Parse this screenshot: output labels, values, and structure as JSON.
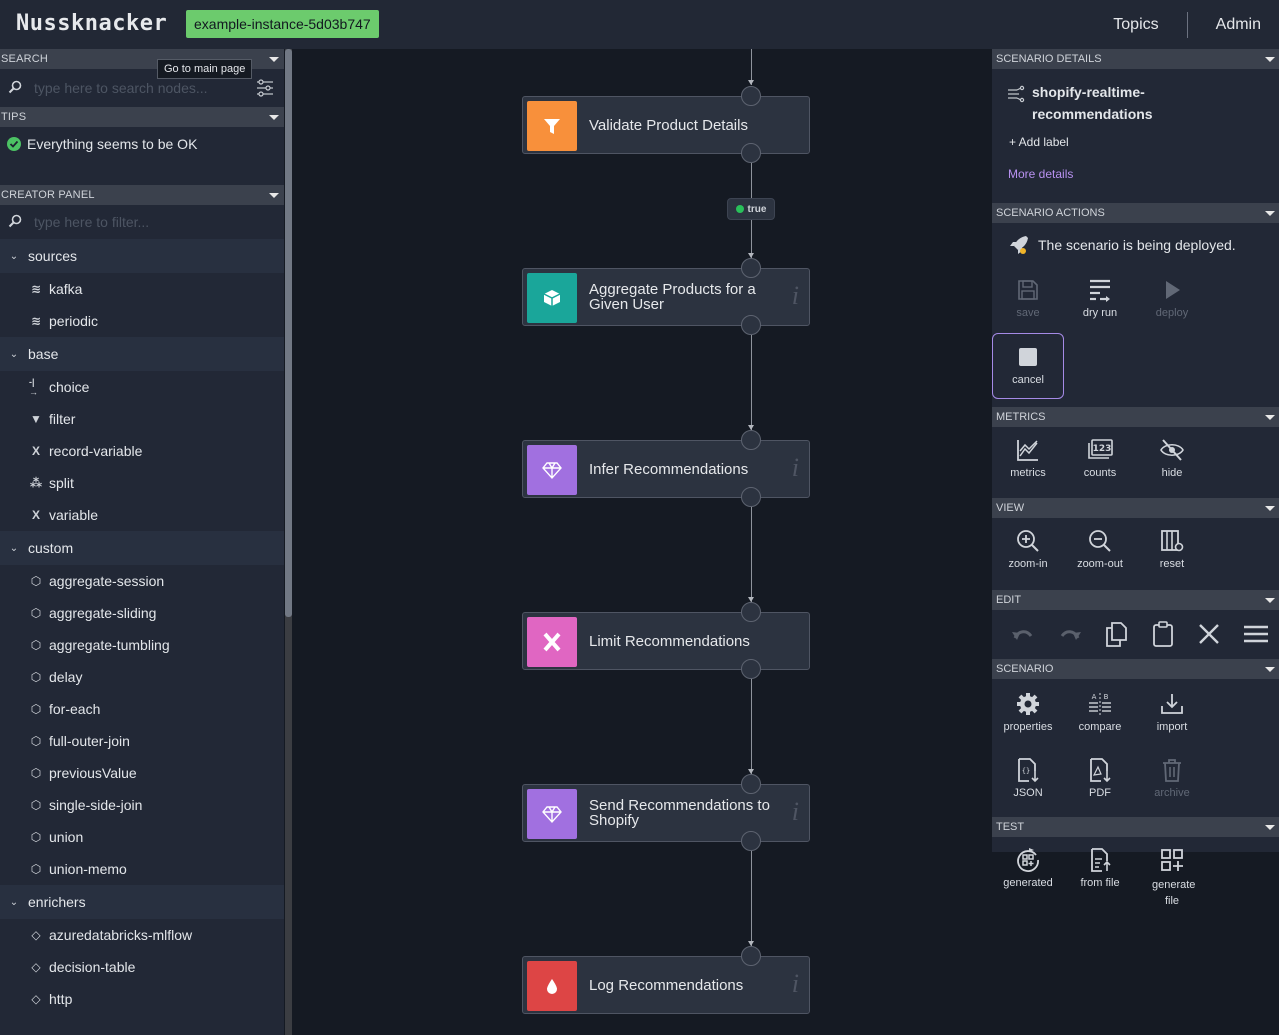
{
  "header": {
    "logo": "Nussknacker",
    "environment": "example-instance-5d03b747",
    "env_color": "#6ccb6d",
    "nav": [
      "Topics",
      "Admin"
    ]
  },
  "left": {
    "search": {
      "title": "SEARCH",
      "placeholder": "type here to search nodes...",
      "tooltip": "Go to main page"
    },
    "tips": {
      "title": "TIPS",
      "message": "Everything seems to be OK"
    },
    "creator": {
      "title": "CREATOR PANEL",
      "placeholder": "type here to filter...",
      "categories": [
        {
          "name": "sources",
          "items": [
            {
              "label": "kafka",
              "icon": "database-icon"
            },
            {
              "label": "periodic",
              "icon": "database-icon"
            }
          ]
        },
        {
          "name": "base",
          "items": [
            {
              "label": "choice",
              "icon": "choice-icon"
            },
            {
              "label": "filter",
              "icon": "filter-icon"
            },
            {
              "label": "record-variable",
              "icon": "variable-icon"
            },
            {
              "label": "split",
              "icon": "split-icon"
            },
            {
              "label": "variable",
              "icon": "variable-icon"
            }
          ]
        },
        {
          "name": "custom",
          "items": [
            {
              "label": "aggregate-session",
              "icon": "cube-icon"
            },
            {
              "label": "aggregate-sliding",
              "icon": "cube-icon"
            },
            {
              "label": "aggregate-tumbling",
              "icon": "cube-icon"
            },
            {
              "label": "delay",
              "icon": "cube-icon"
            },
            {
              "label": "for-each",
              "icon": "cube-icon"
            },
            {
              "label": "full-outer-join",
              "icon": "cube-icon"
            },
            {
              "label": "previousValue",
              "icon": "cube-icon"
            },
            {
              "label": "single-side-join",
              "icon": "cube-icon"
            },
            {
              "label": "union",
              "icon": "cube-icon"
            },
            {
              "label": "union-memo",
              "icon": "cube-icon"
            }
          ]
        },
        {
          "name": "enrichers",
          "items": [
            {
              "label": "azuredatabricks-mlflow",
              "icon": "gem-icon"
            },
            {
              "label": "decision-table",
              "icon": "gem-icon"
            },
            {
              "label": "http",
              "icon": "gem-icon"
            }
          ]
        }
      ]
    }
  },
  "graph": {
    "nodes": [
      {
        "title": "Validate Product Details",
        "type": "filter",
        "color": "#f8903b",
        "info": false
      },
      {
        "title": "Aggregate Products for a Given User",
        "type": "custom",
        "color": "#1aa69a",
        "info": true
      },
      {
        "title": "Infer Recommendations",
        "type": "enricher",
        "color": "#a170e0",
        "info": true
      },
      {
        "title": "Limit Recommendations",
        "type": "variable",
        "color": "#e066c2",
        "info": false
      },
      {
        "title": "Send Recommendations to Shopify",
        "type": "enricher",
        "color": "#a170e0",
        "info": true
      },
      {
        "title": "Log Recommendations",
        "type": "sink",
        "color": "#dd4545",
        "info": true
      }
    ],
    "edge_label": "true",
    "info_glyph": "i"
  },
  "right": {
    "details": {
      "title": "SCENARIO DETAILS",
      "name": "shopify-realtime-recommendations",
      "add_label": "+ Add label",
      "more": "More details"
    },
    "actions": {
      "title": "SCENARIO ACTIONS",
      "status": "The scenario is being deployed.",
      "buttons": [
        {
          "label": "save",
          "disabled": true
        },
        {
          "label": "dry run",
          "disabled": false
        },
        {
          "label": "deploy",
          "disabled": true
        },
        {
          "label": "cancel",
          "disabled": false
        }
      ]
    },
    "metrics": {
      "title": "METRICS",
      "buttons": [
        "metrics",
        "counts",
        "hide"
      ]
    },
    "view": {
      "title": "VIEW",
      "buttons": [
        "zoom-in",
        "zoom-out",
        "reset"
      ]
    },
    "edit": {
      "title": "EDIT"
    },
    "scenario": {
      "title": "SCENARIO",
      "buttons": [
        "properties",
        "compare",
        "import",
        "JSON",
        "PDF",
        "archive"
      ]
    },
    "test": {
      "title": "TEST",
      "buttons": [
        "generated",
        "from file",
        "generate file"
      ]
    }
  }
}
